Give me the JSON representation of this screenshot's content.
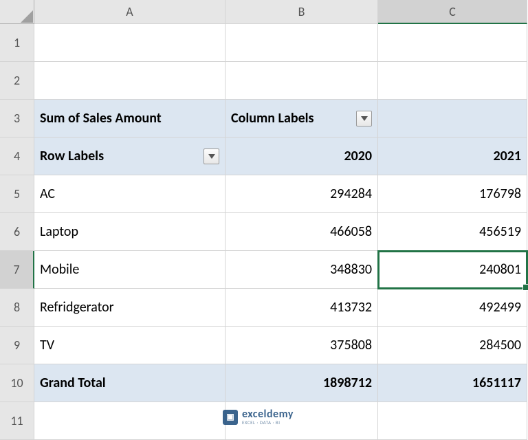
{
  "columns": [
    "A",
    "B",
    "C"
  ],
  "rows": [
    "1",
    "2",
    "3",
    "4",
    "5",
    "6",
    "7",
    "8",
    "9",
    "10",
    "11"
  ],
  "pivot": {
    "value_field": "Sum of Sales Amount",
    "column_labels_title": "Column Labels",
    "row_labels_title": "Row Labels",
    "years": [
      "2020",
      "2021"
    ],
    "items": [
      "AC",
      "Laptop",
      "Mobile",
      "Refridgerator",
      "TV"
    ],
    "values": {
      "AC": {
        "2020": "294284",
        "2021": "176798"
      },
      "Laptop": {
        "2020": "466058",
        "2021": "456519"
      },
      "Mobile": {
        "2020": "348830",
        "2021": "240801"
      },
      "Refridgerator": {
        "2020": "413732",
        "2021": "492499"
      },
      "TV": {
        "2020": "375808",
        "2021": "284500"
      }
    },
    "grand_total_label": "Grand Total",
    "grand_totals": {
      "2020": "1898712",
      "2021": "1651117"
    }
  },
  "selected_cell": {
    "row": 7,
    "col": "C"
  },
  "watermark": {
    "brand": "exceldemy",
    "tagline": "EXCEL · DATA · BI"
  },
  "chart_data": {
    "type": "table",
    "title": "Sum of Sales Amount",
    "categories": [
      "2020",
      "2021"
    ],
    "series": [
      {
        "name": "AC",
        "values": [
          294284,
          176798
        ]
      },
      {
        "name": "Laptop",
        "values": [
          466058,
          456519
        ]
      },
      {
        "name": "Mobile",
        "values": [
          348830,
          240801
        ]
      },
      {
        "name": "Refridgerator",
        "values": [
          413732,
          492499
        ]
      },
      {
        "name": "TV",
        "values": [
          375808,
          284500
        ]
      }
    ],
    "totals": {
      "2020": 1898712,
      "2021": 1651117
    }
  }
}
